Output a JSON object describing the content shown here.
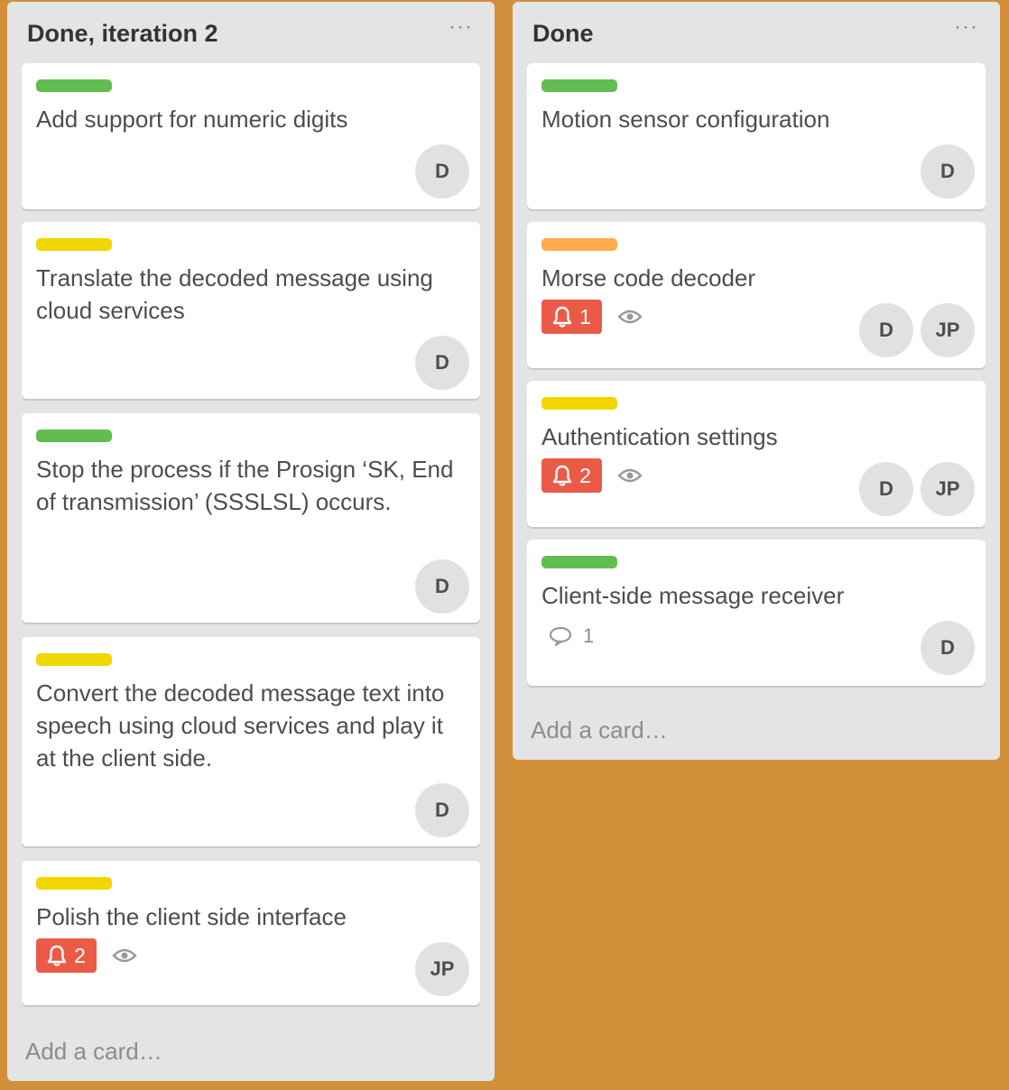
{
  "colors": {
    "background": "#d28f3a",
    "list_bg": "#e2e4e6",
    "label_green": "#61bd4f",
    "label_yellow": "#f2d600",
    "label_orange": "#ffab4a",
    "badge_red": "#eb5a46"
  },
  "lists": [
    {
      "title": "Done, iteration 2",
      "menu": "···",
      "add_card": "Add a card…",
      "cards": [
        {
          "label_color": "green",
          "title": "Add support for numeric digits",
          "members": [
            "D"
          ]
        },
        {
          "label_color": "yellow",
          "title": "Translate the decoded message using cloud services",
          "members": [
            "D"
          ]
        },
        {
          "label_color": "green",
          "title": "Stop the process if the Prosign ‘SK, End of transmission’ (SSSLSL) occurs.",
          "members": [
            "D"
          ]
        },
        {
          "label_color": "yellow",
          "title": "Convert the decoded message text into speech using cloud services and play it at the client side.",
          "members": [
            "D"
          ]
        },
        {
          "label_color": "yellow",
          "title": "Polish the client side interface",
          "due_badge": "2",
          "watching": true,
          "members": [
            "JP"
          ]
        }
      ]
    },
    {
      "title": "Done",
      "menu": "···",
      "add_card": "Add a card…",
      "cards": [
        {
          "label_color": "green",
          "title": "Motion sensor configuration",
          "members": [
            "D"
          ]
        },
        {
          "label_color": "orange",
          "title": "Morse code decoder",
          "due_badge": "1",
          "watching": true,
          "members": [
            "D",
            "JP"
          ]
        },
        {
          "label_color": "yellow",
          "title": "Authentication settings",
          "due_badge": "2",
          "watching": true,
          "members": [
            "D",
            "JP"
          ]
        },
        {
          "label_color": "green",
          "title": "Client-side message receiver",
          "comments": "1",
          "members": [
            "D"
          ]
        }
      ]
    }
  ]
}
